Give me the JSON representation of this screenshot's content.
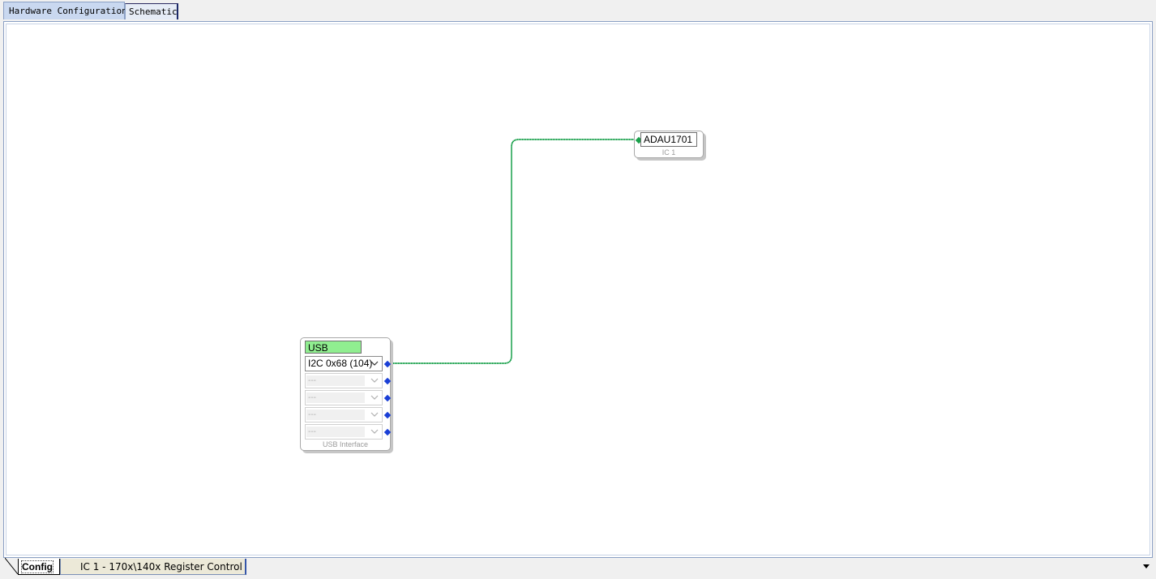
{
  "top_tabs": [
    {
      "label": "Hardware Configuration",
      "active": true
    },
    {
      "label": "Schematic",
      "active": false
    }
  ],
  "usb_block": {
    "title": "USB",
    "title_color": "#90ee90",
    "channels": [
      {
        "value": "I2C 0x68 (104)",
        "enabled": true
      },
      {
        "value": "---",
        "enabled": false
      },
      {
        "value": "---",
        "enabled": false
      },
      {
        "value": "---",
        "enabled": false
      },
      {
        "value": "---",
        "enabled": false
      }
    ],
    "caption": "USB Interface"
  },
  "ic_block": {
    "title": "ADAU1701",
    "caption": "IC 1"
  },
  "wire_color": "#19a04b",
  "port_color": "#1a3fd6",
  "bottom_tabs": [
    {
      "label": "Config",
      "active": true
    },
    {
      "label": "IC 1 - 170x\\140x Register Control",
      "active": false
    }
  ],
  "icons": {
    "dropdown": "chevron-down-icon",
    "scroll": "scroll-down-arrow-icon"
  }
}
